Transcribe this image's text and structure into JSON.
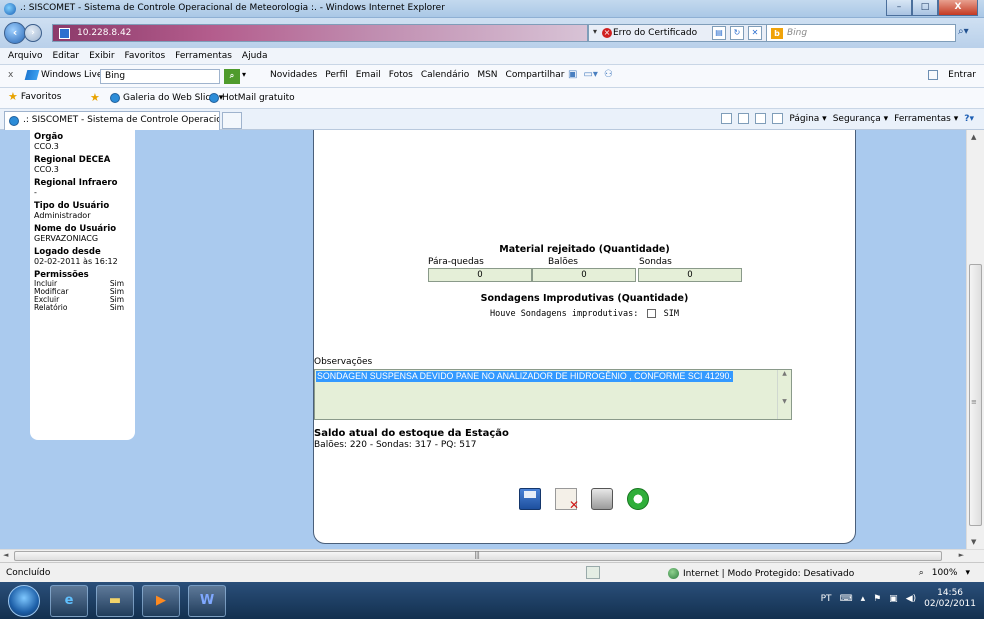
{
  "window": {
    "title": ".: SISCOMET - Sistema de Controle Operacional de Meteorologia :. - Windows Internet Explorer",
    "controls": [
      "–",
      "□",
      "X"
    ]
  },
  "address_bar": {
    "url": "10.228.8.42",
    "certificate_error": "Erro do Certificado",
    "search_placeholder": "Bing"
  },
  "menu": [
    "Arquivo",
    "Editar",
    "Exibir",
    "Favoritos",
    "Ferramentas",
    "Ajuda"
  ],
  "windows_live_bar": {
    "close": "x",
    "brand": "Windows Live",
    "search_value": "Bing",
    "links": [
      "Novidades",
      "Perfil",
      "Email",
      "Fotos",
      "Calendário",
      "MSN",
      "Compartilhar"
    ],
    "enter": "Entrar"
  },
  "favorites_bar": {
    "favorites": "Favoritos",
    "links": [
      "Galeria do Web Slice ▾",
      "HotMail gratuito"
    ]
  },
  "tab": {
    "title": ".: SISCOMET - Sistema de Controle Operacional d..."
  },
  "command_bar": [
    "Página ▾",
    "Segurança ▾",
    "Ferramentas ▾"
  ],
  "sidebar": {
    "orgao": {
      "label": "Orgão",
      "value": "CCO.3"
    },
    "regional_decea": {
      "label": "Regional DECEA",
      "value": "CCO.3"
    },
    "regional_infraero": {
      "label": "Regional Infraero",
      "value": "-"
    },
    "tipo_usuario": {
      "label": "Tipo do Usuário",
      "value": "Administrador"
    },
    "nome_usuario": {
      "label": "Nome do Usuário",
      "value": "GERVAZONIACG"
    },
    "logado_desde": {
      "label": "Logado desde",
      "value": "02-02-2011 às 16:12"
    },
    "permissoes": {
      "label": "Permissões",
      "rows": [
        {
          "name": "Incluir",
          "value": "Sim"
        },
        {
          "name": "Modificar",
          "value": "Sim"
        },
        {
          "name": "Excluir",
          "value": "Sim"
        },
        {
          "name": "Relatório",
          "value": "Sim"
        }
      ]
    }
  },
  "form": {
    "material_rejeitado": {
      "title": "Material rejeitado (Quantidade)",
      "parachutes_label": "Pára-quedas",
      "parachutes_value": "0",
      "balloons_label": "Balões",
      "balloons_value": "0",
      "probes_label": "Sondas",
      "probes_value": "0"
    },
    "sondagens_improdutivas": {
      "title": "Sondagens Improdutivas (Quantidade)",
      "question": "Houve Sondagens improdutivas:",
      "checkbox_label": "SIM",
      "checked": false
    },
    "observacoes": {
      "label": "Observações",
      "value": "SONDAGEN SUSPENSA DEVIDO PANE NO ANALIZADOR DE HIDROGÊNIO , CONFORME SCI 41290."
    },
    "estoque": {
      "title": "Saldo atual do estoque da Estação",
      "value": "Balões: 220 - Sondas: 317 - PQ: 517"
    },
    "actions": [
      "save-icon",
      "delete-icon",
      "print-icon",
      "refresh-icon"
    ]
  },
  "status_bar": {
    "status": "Concluído",
    "zone": "Internet | Modo Protegido: Desativado",
    "zoom": "100%"
  },
  "taskbar": {
    "language": "PT",
    "time": "14:56",
    "date": "02/02/2011"
  }
}
